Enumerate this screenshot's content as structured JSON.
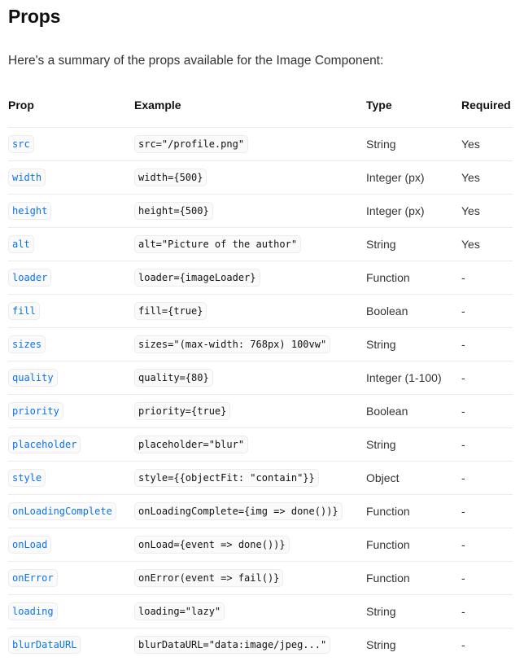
{
  "heading": "Props",
  "intro": "Here's a summary of the props available for the Image Component:",
  "table": {
    "headers": {
      "prop": "Prop",
      "example": "Example",
      "type": "Type",
      "required": "Required"
    },
    "rows": [
      {
        "prop": "src",
        "example": "src=\"/profile.png\"",
        "type": "String",
        "required": "Yes"
      },
      {
        "prop": "width",
        "example": "width={500}",
        "type": "Integer (px)",
        "required": "Yes"
      },
      {
        "prop": "height",
        "example": "height={500}",
        "type": "Integer (px)",
        "required": "Yes"
      },
      {
        "prop": "alt",
        "example": "alt=\"Picture of the author\"",
        "type": "String",
        "required": "Yes"
      },
      {
        "prop": "loader",
        "example": "loader={imageLoader}",
        "type": "Function",
        "required": "-"
      },
      {
        "prop": "fill",
        "example": "fill={true}",
        "type": "Boolean",
        "required": "-"
      },
      {
        "prop": "sizes",
        "example": "sizes=\"(max-width: 768px) 100vw\"",
        "type": "String",
        "required": "-"
      },
      {
        "prop": "quality",
        "example": "quality={80}",
        "type": "Integer (1-100)",
        "required": "-"
      },
      {
        "prop": "priority",
        "example": "priority={true}",
        "type": "Boolean",
        "required": "-"
      },
      {
        "prop": "placeholder",
        "example": "placeholder=\"blur\"",
        "type": "String",
        "required": "-"
      },
      {
        "prop": "style",
        "example": "style={{objectFit: \"contain\"}}",
        "type": "Object",
        "required": "-"
      },
      {
        "prop": "onLoadingComplete",
        "example": "onLoadingComplete={img => done())}",
        "type": "Function",
        "required": "-"
      },
      {
        "prop": "onLoad",
        "example": "onLoad={event => done())}",
        "type": "Function",
        "required": "-"
      },
      {
        "prop": "onError",
        "example": "onError(event => fail()}",
        "type": "Function",
        "required": "-"
      },
      {
        "prop": "loading",
        "example": "loading=\"lazy\"",
        "type": "String",
        "required": "-"
      },
      {
        "prop": "blurDataURL",
        "example": "blurDataURL=\"data:image/jpeg...\"",
        "type": "String",
        "required": "-"
      }
    ]
  }
}
